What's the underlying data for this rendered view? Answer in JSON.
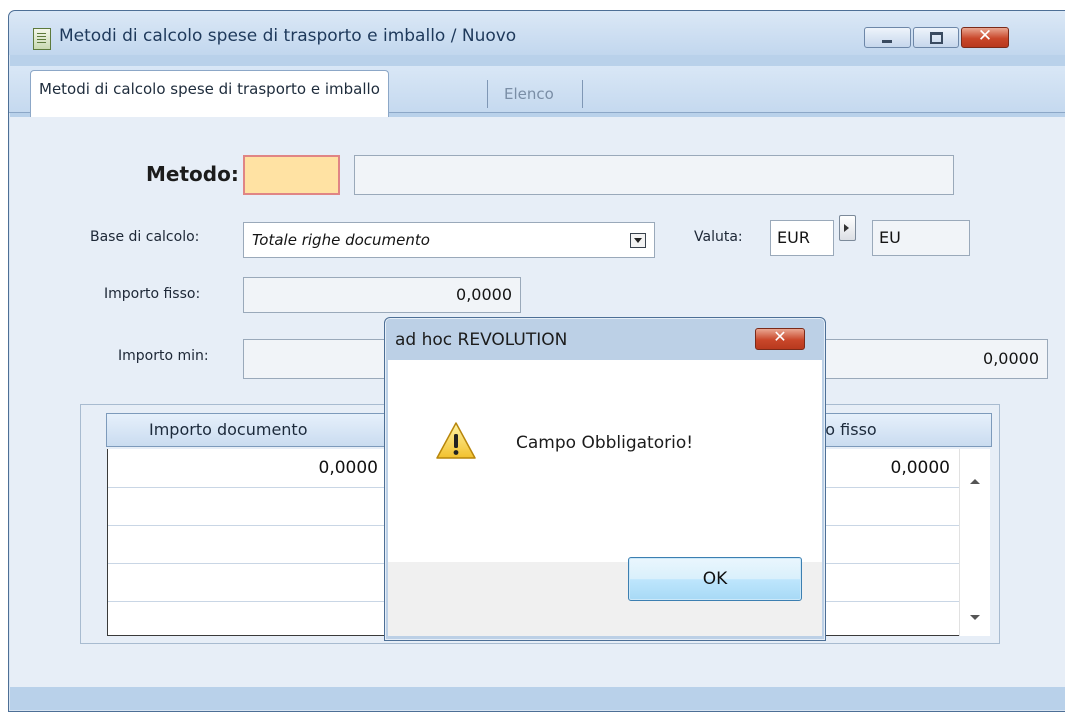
{
  "window": {
    "title": "Metodi di calcolo spese di trasporto e imballo / Nuovo",
    "caption_buttons": [
      "minimize-icon",
      "maximize-icon",
      "close-icon"
    ],
    "close_glyph": "✕"
  },
  "tabs": [
    {
      "label": "Metodi di calcolo spese di trasporto e imballo",
      "active": true
    },
    {
      "label": "Elenco",
      "active": false
    }
  ],
  "form": {
    "metodo_label": "Metodo:",
    "metodo_code": "",
    "metodo_description": "",
    "base_label": "Base di calcolo:",
    "base_value": "Totale righe documento",
    "valuta_label": "Valuta:",
    "valuta_code": "EUR",
    "valuta_desc": "EU",
    "importo_fisso_label": "Importo fisso:",
    "importo_fisso_value": "0,0000",
    "importo_min_label": "Importo min:",
    "importo_max_value": "0,0000"
  },
  "grid": {
    "columns": [
      "Importo documento",
      "to fisso"
    ],
    "rows": [
      {
        "importo_documento": "0,0000",
        "importo_fisso": "0,0000"
      },
      {
        "importo_documento": "",
        "importo_fisso": ""
      },
      {
        "importo_documento": "",
        "importo_fisso": ""
      },
      {
        "importo_documento": "",
        "importo_fisso": ""
      },
      {
        "importo_documento": "",
        "importo_fisso": ""
      }
    ]
  },
  "dialog": {
    "title": "ad hoc REVOLUTION",
    "close_glyph": "✕",
    "message": "Campo Obbligatorio!",
    "icon": "warning-icon",
    "ok_label": "OK"
  },
  "colors": {
    "required_field": "#ffe2a3",
    "required_border": "#e08585",
    "close_button": "#c9472a",
    "window_frame": "#b9d1ea"
  }
}
